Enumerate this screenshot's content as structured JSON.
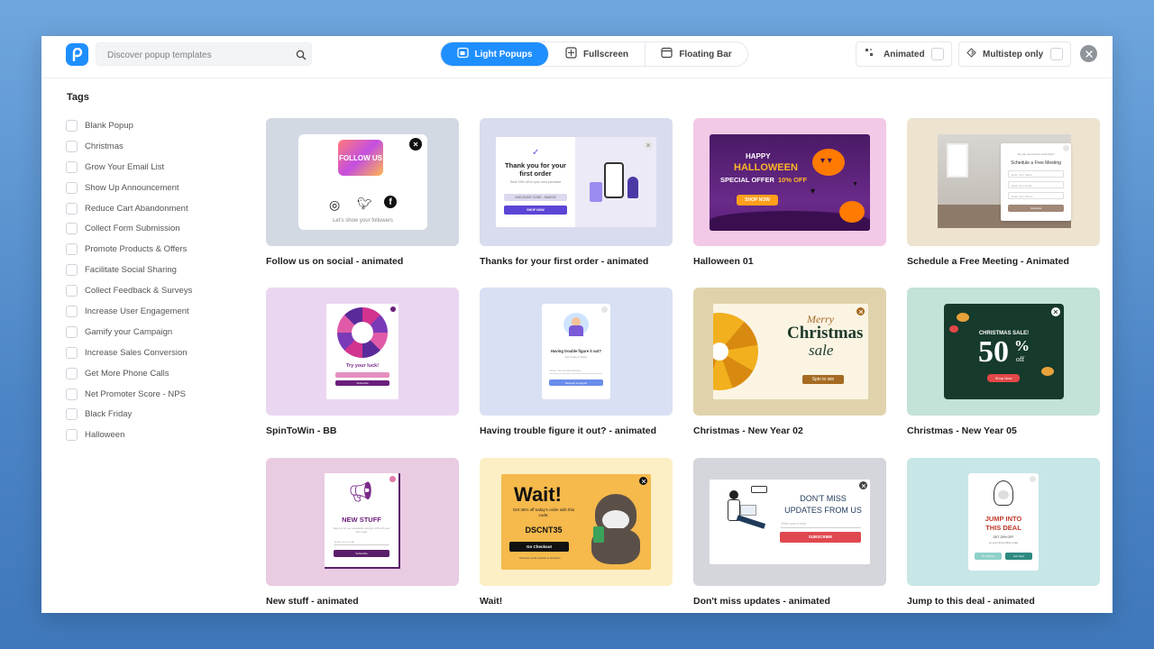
{
  "search": {
    "placeholder": "Discover popup templates"
  },
  "tabs": [
    {
      "label": "Light Popups",
      "icon": "light-popup-icon",
      "active": true
    },
    {
      "label": "Fullscreen",
      "icon": "fullscreen-icon",
      "active": false
    },
    {
      "label": "Floating Bar",
      "icon": "floating-bar-icon",
      "active": false
    }
  ],
  "filters": {
    "animated_label": "Animated",
    "multistep_label": "Multistep only"
  },
  "sidebar": {
    "title": "Tags",
    "tags": [
      "Blank Popup",
      "Christmas",
      "Grow Your Email List",
      "Show Up Announcement",
      "Reduce Cart Abandonment",
      "Collect Form Submission",
      "Promote Products & Offers",
      "Facilitate Social Sharing",
      "Collect Feedback & Surveys",
      "Increase User Engagement",
      "Gamify your Campaign",
      "Increase Sales Conversion",
      "Get More Phone Calls",
      "Net Promoter Score - NPS",
      "Black Friday",
      "Halloween"
    ]
  },
  "templates": [
    {
      "title": "Follow us on social - animated",
      "bg": "#d3d9e3",
      "preview": {
        "badge": "FOLLOW US",
        "caption": "Let's show your followers"
      }
    },
    {
      "title": "Thanks for your first order - animated",
      "bg": "#d8dcee",
      "preview": {
        "heading": "Thank you for your first order",
        "sub": "Save 20% off on your next purchase",
        "code": "DISCOUNT CODE : SAVE20",
        "cta": "SHOP NOW"
      }
    },
    {
      "title": "Halloween 01",
      "bg": "#f2c9e6",
      "preview": {
        "line1": "HAPPY",
        "line2": "HALLOWEEN",
        "line3a": "SPECIAL OFFER ",
        "line3b": "10% OFF",
        "cta": "SHOP NOW"
      }
    },
    {
      "title": "Schedule a Free Meeting - Animated",
      "bg": "#ede3cf",
      "preview": {
        "small": "Do you need some extra help?",
        "heading": "Schedule a Free Meeting",
        "f1": "Enter Your Name",
        "f2": "Enter Your Email",
        "f3": "Enter Your Phone",
        "cta": "Schedule"
      }
    },
    {
      "title": "SpinToWin - BB",
      "bg": "#ead6f1",
      "preview": {
        "heading": "Try your luck!",
        "cta": "Subscribe"
      }
    },
    {
      "title": "Having trouble figure it out? - animated",
      "bg": "#d9e0f3",
      "preview": {
        "heading": "Having trouble figure it out?",
        "sub": "Get Support Today",
        "field": "Enter Your Email Address",
        "cta": "Request a support"
      }
    },
    {
      "title": "Christmas - New Year 02",
      "bg": "#e0d3ac",
      "preview": {
        "line1": "Merry",
        "line2": "Christmas",
        "line3": "sale",
        "cta": "Spin to win"
      }
    },
    {
      "title": "Christmas - New Year 05",
      "bg": "#c3e2d8",
      "preview": {
        "small": "CHRISTMAS SALE!",
        "big": "50",
        "pct": "%",
        "off": "off",
        "cta": "Shop Now"
      }
    },
    {
      "title": "New stuff - animated",
      "bg": "#e9cbe2",
      "preview": {
        "heading": "NEW STUFF",
        "sub": "Sign up for our newsletter and get 10% off your first order",
        "field": "Enter your email",
        "cta": "Subscribe"
      }
    },
    {
      "title": "Wait!",
      "bg": "#fdefc5",
      "preview": {
        "heading": "Wait!",
        "sub": "Get 35% off today's order with this code;",
        "code": "DSCNT35",
        "cta": "Go Checkout",
        "foot": "Discount code expires in 24 hours"
      }
    },
    {
      "title": "Don't miss updates - animated",
      "bg": "#d4d6db",
      "preview": {
        "line1": "DON'T MISS",
        "line2": "UPDATES FROM US",
        "field": "Enter your e-mail",
        "cta": "SUBSCRIBE"
      }
    },
    {
      "title": "Jump to this deal - animated",
      "bg": "#c7e6e6",
      "preview": {
        "heading1": "JUMP INTO",
        "heading2": "THIS DEAL",
        "sub": "GET 25% OFF",
        "sub2": "on your 2nd online order",
        "b1": "No Thanks",
        "b2": "Get Now"
      }
    }
  ],
  "colors": {
    "accent": "#1f8fff"
  }
}
